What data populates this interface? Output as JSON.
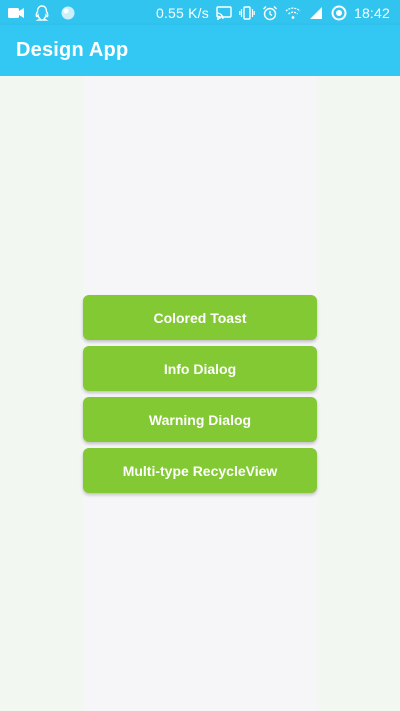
{
  "status_bar": {
    "left_icons": [
      "video-camera-icon",
      "qq-penguin-icon",
      "globe-app-icon"
    ],
    "network_speed": "0.55 K/s",
    "right_icons": [
      "cast-icon",
      "vibrate-icon",
      "alarm-icon",
      "wifi-icon",
      "signal-icon",
      "battery-icon"
    ],
    "time": "18:42"
  },
  "app_bar": {
    "title": "Design App"
  },
  "buttons": [
    {
      "label": "Colored Toast"
    },
    {
      "label": "Info Dialog"
    },
    {
      "label": "Warning Dialog"
    },
    {
      "label": "Multi-type RecycleView"
    }
  ],
  "colors": {
    "status_bar": "#30c4ef",
    "app_bar": "#33c8f3",
    "button": "#82c934",
    "background": "#f3f7f2"
  }
}
